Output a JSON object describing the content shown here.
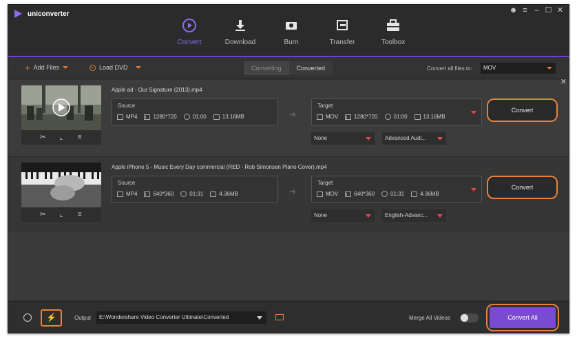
{
  "app": {
    "name": "uniconverter"
  },
  "window_controls": [
    "user-icon",
    "menu-icon",
    "minimize-icon",
    "maximize-icon",
    "close-icon"
  ],
  "nav": {
    "tabs": [
      {
        "label": "Convert",
        "icon": "convert-icon",
        "active": true
      },
      {
        "label": "Download",
        "icon": "download-icon",
        "active": false
      },
      {
        "label": "Burn",
        "icon": "burn-icon",
        "active": false
      },
      {
        "label": "Transfer",
        "icon": "transfer-icon",
        "active": false
      },
      {
        "label": "Toolbox",
        "icon": "toolbox-icon",
        "active": false
      }
    ]
  },
  "toolbar": {
    "add_files": "Add Files",
    "load_dvd": "Load DVD",
    "tab_converting": "Converting",
    "tab_converted": "Converted",
    "convert_all_to_label": "Convert all files to:",
    "convert_all_to_value": "MOV"
  },
  "items": [
    {
      "filename": "Apple ad - Our Signature (2013).mp4",
      "source": {
        "title": "Source",
        "format": "MP4",
        "resolution": "1280*720",
        "duration": "01:00",
        "size": "13.16MB"
      },
      "target": {
        "title": "Target",
        "format": "MOV",
        "resolution": "1280*720",
        "duration": "01:00",
        "size": "13.16MB"
      },
      "subtitle": "None",
      "audio": "Advanced Audi...",
      "convert_label": "Convert"
    },
    {
      "filename": "Apple iPhone 5 - Music Every Day commercial (RED - Rob Simonsen Piano Cover).mp4",
      "source": {
        "title": "Source",
        "format": "MP4",
        "resolution": "640*360",
        "duration": "01:31",
        "size": "4.36MB"
      },
      "target": {
        "title": "Target",
        "format": "MOV",
        "resolution": "640*360",
        "duration": "01:31",
        "size": "4.36MB"
      },
      "subtitle": "None",
      "audio": "English-Advanc...",
      "convert_label": "Convert"
    }
  ],
  "bottom": {
    "output_label": "Output",
    "output_path": "E:\\Wondershare Video Converter Ultimate\\Converted",
    "merge_label": "Merge All Videos",
    "merge_enabled": false,
    "convert_all_label": "Convert All"
  },
  "colors": {
    "accent_purple": "#8a6cf0",
    "button_purple": "#7a4ad0",
    "highlight_orange": "#e8823e",
    "dropdown_red": "#e0484b"
  }
}
